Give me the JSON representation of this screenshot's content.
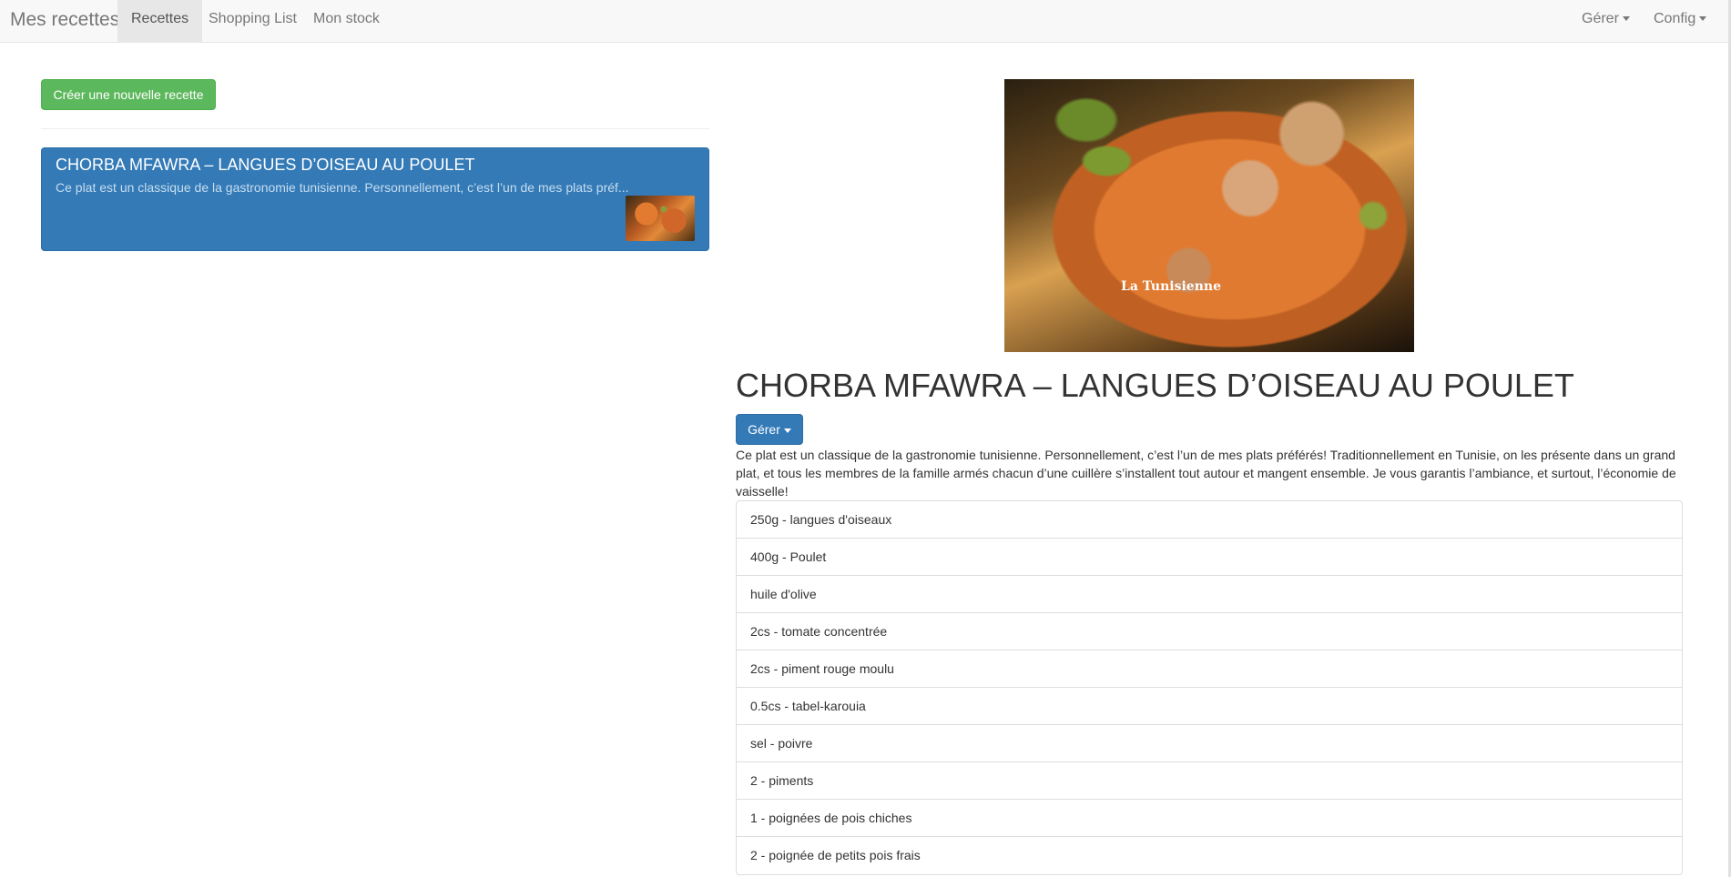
{
  "navbar": {
    "brand": "Mes recettes",
    "tabs": [
      {
        "label": "Recettes",
        "active": true
      },
      {
        "label": "Shopping List",
        "active": false
      },
      {
        "label": "Mon stock",
        "active": false
      }
    ],
    "right_menus": [
      {
        "label": "Gérer"
      },
      {
        "label": "Config"
      }
    ]
  },
  "sidebar": {
    "new_recipe_label": "Créer une nouvelle recette",
    "recipes": [
      {
        "title": "CHORBA MFAWRA – LANGUES D’OISEAU AU POULET",
        "excerpt": "Ce plat est un classique de la gastronomie tunisienne. Personnellement, c’est l’un de mes plats préf..."
      }
    ]
  },
  "detail": {
    "image_watermark": "La Tunisienne",
    "title": "CHORBA MFAWRA – LANGUES D’OISEAU AU POULET",
    "manage_label": "Gérer",
    "description": "Ce plat est un classique de la gastronomie tunisienne. Personnellement, c’est l’un de mes plats préférés! Traditionnellement en Tunisie, on les présente dans un grand plat, et tous les membres de la famille armés chacun d’une cuillère s’installent tout autour et mangent ensemble. Je vous garantis l’ambiance, et surtout, l’économie de vaisselle!",
    "ingredients": [
      "250g - langues d'oiseaux",
      "400g - Poulet",
      "huile d'olive",
      "2cs - tomate concentrée",
      "2cs - piment rouge moulu",
      "0.5cs - tabel-karouia",
      "sel - poivre",
      "2 - piments",
      "1 - poignées de pois chiches",
      "2 - poignée de petits pois frais"
    ]
  },
  "colors": {
    "success": "#5cb85c",
    "primary": "#337ab7",
    "navbar_bg": "#f8f8f8"
  }
}
